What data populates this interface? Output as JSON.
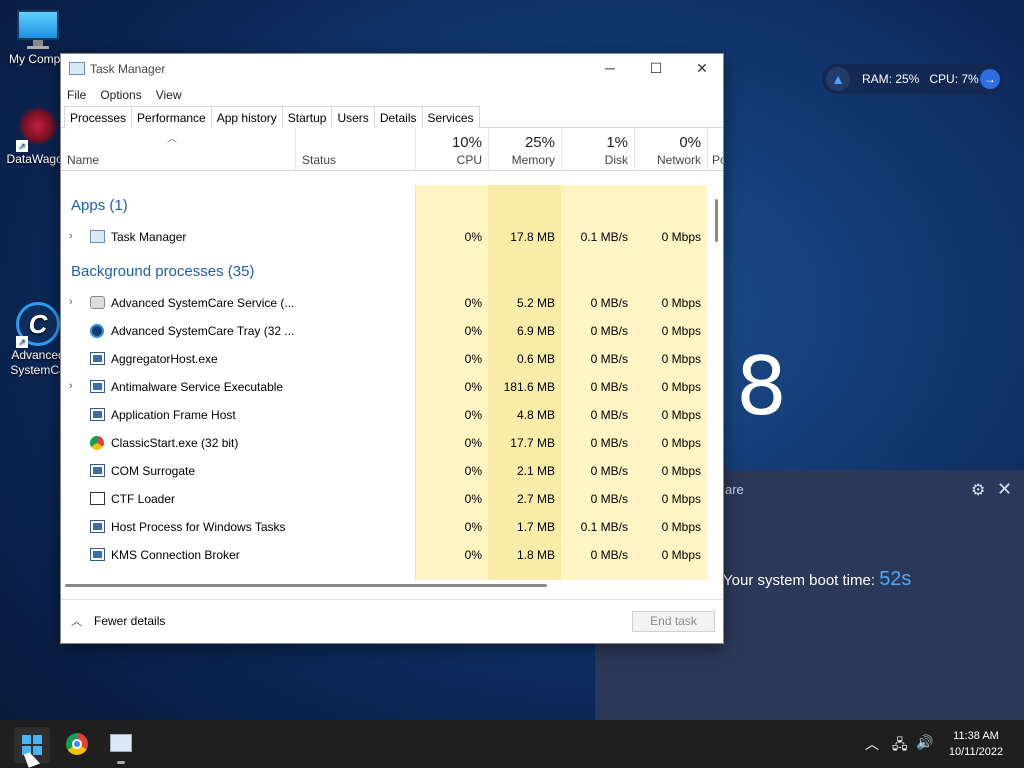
{
  "desktop": {
    "icons": [
      {
        "label": "My Compu",
        "icon": "computer-icon"
      },
      {
        "label": "DataWagon",
        "icon": "datawagon-icon"
      },
      {
        "label": "Advanced",
        "label2": "SystemCa",
        "icon": "advanced-systemcare-icon"
      }
    ],
    "big_digit": "8"
  },
  "widget": {
    "ram_label": "RAM: 25%",
    "cpu_label": "CPU: 7%",
    "rocket_icon": "rocket-icon",
    "arrow_icon": "arrow-right-icon"
  },
  "asc_panel": {
    "title_partial": "are",
    "boot_text": "Your system boot time:",
    "boot_value": "52s"
  },
  "task_manager": {
    "title": "Task Manager",
    "menu": [
      "File",
      "Options",
      "View"
    ],
    "tabs": [
      "Processes",
      "Performance",
      "App history",
      "Startup",
      "Users",
      "Details",
      "Services"
    ],
    "active_tab": "Processes",
    "columns": {
      "name": "Name",
      "status": "Status",
      "cpu": {
        "pct": "10%",
        "label": "CPU"
      },
      "memory": {
        "pct": "25%",
        "label": "Memory"
      },
      "disk": {
        "pct": "1%",
        "label": "Disk"
      },
      "network": {
        "pct": "0%",
        "label": "Network"
      },
      "power_partial": "Po"
    },
    "groups": {
      "apps": "Apps (1)",
      "background": "Background processes (35)"
    },
    "apps": [
      {
        "name": "Task Manager",
        "expand": true,
        "icon": "taskmanager",
        "cpu": "0%",
        "memory": "17.8 MB",
        "disk": "0.1 MB/s",
        "network": "0 Mbps"
      }
    ],
    "background": [
      {
        "name": "Advanced SystemCare Service (...",
        "expand": true,
        "icon": "gear",
        "cpu": "0%",
        "memory": "5.2 MB",
        "disk": "0 MB/s",
        "network": "0 Mbps"
      },
      {
        "name": "Advanced SystemCare Tray (32 ...",
        "expand": false,
        "icon": "circ",
        "cpu": "0%",
        "memory": "6.9 MB",
        "disk": "0 MB/s",
        "network": "0 Mbps"
      },
      {
        "name": "AggregatorHost.exe",
        "expand": false,
        "icon": "box",
        "cpu": "0%",
        "memory": "0.6 MB",
        "disk": "0 MB/s",
        "network": "0 Mbps"
      },
      {
        "name": "Antimalware Service Executable",
        "expand": true,
        "icon": "box",
        "cpu": "0%",
        "memory": "181.6 MB",
        "disk": "0 MB/s",
        "network": "0 Mbps"
      },
      {
        "name": "Application Frame Host",
        "expand": false,
        "icon": "box",
        "cpu": "0%",
        "memory": "4.8 MB",
        "disk": "0 MB/s",
        "network": "0 Mbps"
      },
      {
        "name": "ClassicStart.exe (32 bit)",
        "expand": false,
        "icon": "chrome",
        "cpu": "0%",
        "memory": "17.7 MB",
        "disk": "0 MB/s",
        "network": "0 Mbps"
      },
      {
        "name": "COM Surrogate",
        "expand": false,
        "icon": "box",
        "cpu": "0%",
        "memory": "2.1 MB",
        "disk": "0 MB/s",
        "network": "0 Mbps"
      },
      {
        "name": "CTF Loader",
        "expand": false,
        "icon": "pen",
        "cpu": "0%",
        "memory": "2.7 MB",
        "disk": "0 MB/s",
        "network": "0 Mbps"
      },
      {
        "name": "Host Process for Windows Tasks",
        "expand": false,
        "icon": "box",
        "cpu": "0%",
        "memory": "1.7 MB",
        "disk": "0.1 MB/s",
        "network": "0 Mbps"
      },
      {
        "name": "KMS Connection Broker",
        "expand": false,
        "icon": "box",
        "cpu": "0%",
        "memory": "1.8 MB",
        "disk": "0 MB/s",
        "network": "0 Mbps"
      }
    ],
    "footer": {
      "fewer_details": "Fewer details",
      "end_task": "End task"
    }
  },
  "taskbar": {
    "time": "11:38 AM",
    "date": "10/11/2022"
  },
  "colors": {
    "heat_light": "#fff4c4",
    "heat_medium": "#f9eca8",
    "heat_dark": "#f5e08a",
    "group_blue": "#1f5fa8"
  }
}
